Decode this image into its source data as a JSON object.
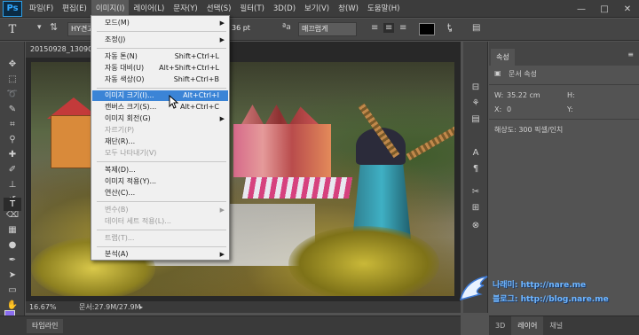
{
  "app": {
    "logo": "Ps"
  },
  "menubar": {
    "items": [
      "파일(F)",
      "편집(E)",
      "이미지(I)",
      "레이어(L)",
      "문자(Y)",
      "선택(S)",
      "필터(T)",
      "3D(D)",
      "보기(V)",
      "창(W)",
      "도움말(H)"
    ],
    "active_index": 2
  },
  "window": {
    "minimize": "—",
    "maximize": "□",
    "close": "✕"
  },
  "options": {
    "tool_icon": "T",
    "font_name": "HY견고",
    "font_size": "36 pt",
    "aa_icon": "ªa",
    "antialias": "매끄럽게",
    "text_color": "#000000"
  },
  "document": {
    "tab": "20150928_13090",
    "zoom": "16.67%",
    "doc_size": "문서:27.9M/27.9M"
  },
  "timeline": {
    "tab": "타임라인"
  },
  "properties": {
    "tab": "속성",
    "menu": "≡",
    "doc_label": "문서 속성",
    "w_label": "W:",
    "w_value": "35.22 cm",
    "h_label": "H:",
    "x_label": "X:",
    "x_value": "0",
    "y_label": "Y:",
    "resolution": "해상도: 300 픽셀/인치"
  },
  "bottom_tabs": {
    "tab1": "3D",
    "tab2": "레이어",
    "tab3": "채널"
  },
  "watermark": {
    "line1": "나래미: http://nare.me",
    "line2": "블로그: http://blog.nare.me"
  },
  "image_menu": {
    "items": [
      {
        "label": "모드(M)",
        "shortcut": "",
        "submenu": true,
        "disabled": false
      },
      {
        "label": "조정(J)",
        "shortcut": "",
        "submenu": true,
        "disabled": false
      },
      {
        "label": "자동 톤(N)",
        "shortcut": "Shift+Ctrl+L",
        "submenu": false,
        "disabled": false
      },
      {
        "label": "자동 대비(U)",
        "shortcut": "Alt+Shift+Ctrl+L",
        "submenu": false,
        "disabled": false
      },
      {
        "label": "자동 색상(O)",
        "shortcut": "Shift+Ctrl+B",
        "submenu": false,
        "disabled": false
      },
      {
        "label": "이미지 크기(I)...",
        "shortcut": "Alt+Ctrl+I",
        "submenu": false,
        "disabled": false,
        "highlight": true
      },
      {
        "label": "캔버스 크기(S)...",
        "shortcut": "Alt+Ctrl+C",
        "submenu": false,
        "disabled": false
      },
      {
        "label": "이미지 회전(G)",
        "shortcut": "",
        "submenu": true,
        "disabled": false
      },
      {
        "label": "자르기(P)",
        "shortcut": "",
        "submenu": false,
        "disabled": true
      },
      {
        "label": "재단(R)...",
        "shortcut": "",
        "submenu": false,
        "disabled": false
      },
      {
        "label": "모두 나타내기(V)",
        "shortcut": "",
        "submenu": false,
        "disabled": true
      },
      {
        "label": "복제(D)...",
        "shortcut": "",
        "submenu": false,
        "disabled": false
      },
      {
        "label": "이미지 적용(Y)...",
        "shortcut": "",
        "submenu": false,
        "disabled": false
      },
      {
        "label": "연산(C)...",
        "shortcut": "",
        "submenu": false,
        "disabled": false
      },
      {
        "label": "변수(B)",
        "shortcut": "",
        "submenu": true,
        "disabled": true
      },
      {
        "label": "데이터 세트 적용(L)...",
        "shortcut": "",
        "submenu": false,
        "disabled": true
      },
      {
        "label": "트랩(T)...",
        "shortcut": "",
        "submenu": false,
        "disabled": true
      },
      {
        "label": "분석(A)",
        "shortcut": "",
        "submenu": true,
        "disabled": false
      }
    ]
  }
}
